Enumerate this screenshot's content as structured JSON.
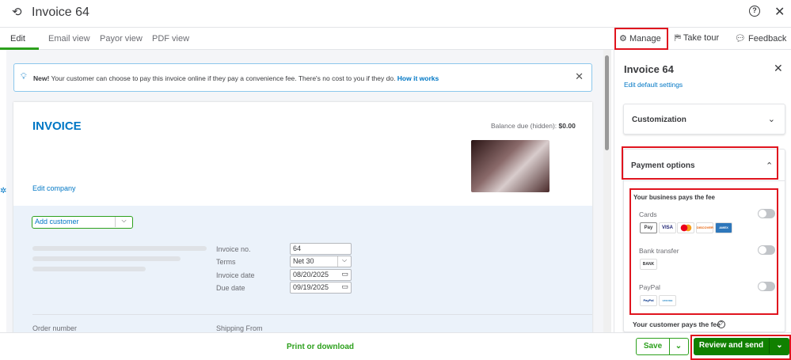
{
  "header": {
    "title": "Invoice 64",
    "help_icon": "help-circle-icon",
    "close_icon": "close-icon",
    "history_icon": "history-icon"
  },
  "tabs": [
    {
      "label": "Edit"
    },
    {
      "label": "Email view"
    },
    {
      "label": "Payor view"
    },
    {
      "label": "PDF view"
    }
  ],
  "toolbar": {
    "manage": "Manage",
    "take_tour": "Take tour",
    "feedback": "Feedback"
  },
  "notice": {
    "bold": "New!",
    "text": " Your customer can choose to pay this invoice online if they pay a convenience fee. There's no cost to you if they do. ",
    "link": "How it works"
  },
  "invoice": {
    "heading": "INVOICE",
    "balance_label": "Balance due (hidden): ",
    "balance_value": "$0.00",
    "edit_company": "Edit company",
    "customer_placeholder": "Add customer",
    "fields": [
      {
        "label": "Invoice no.",
        "value": "64"
      },
      {
        "label": "Terms",
        "value": "Net 30"
      },
      {
        "label": "Invoice date",
        "value": "08/20/2025"
      },
      {
        "label": "Due date",
        "value": "09/19/2025"
      }
    ],
    "order_number": "Order number",
    "shipping_from": "Shipping From"
  },
  "panel": {
    "title": "Invoice 64",
    "edit_defaults": "Edit default settings",
    "customization": "Customization",
    "payment_options": "Payment options",
    "business_pays": "Your business pays the fee",
    "methods": [
      {
        "name": "Cards",
        "enabled": false,
        "logos": [
          "Pay",
          "VISA",
          "MC",
          "DISCOVER",
          "AMEX"
        ]
      },
      {
        "name": "Bank transfer",
        "enabled": false,
        "logos": [
          "BANK"
        ]
      },
      {
        "name": "PayPal",
        "enabled": false,
        "logos": [
          "PayPal",
          "venmo"
        ]
      }
    ],
    "customer_pays": "Your customer pays the fee"
  },
  "footer": {
    "print": "Print or download",
    "save": "Save",
    "review_send": "Review and send"
  },
  "colors": {
    "accent": "#2ca01c",
    "link": "#0077c5",
    "highlight": "#e0141e"
  }
}
